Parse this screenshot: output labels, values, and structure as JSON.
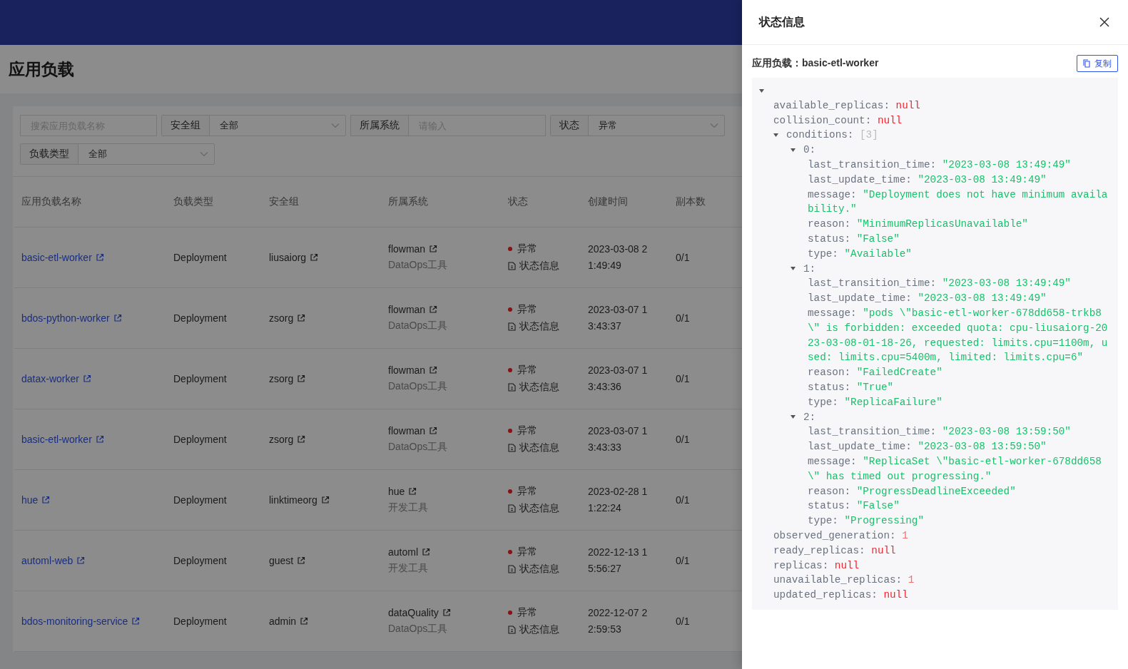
{
  "page": {
    "title": "应用负载"
  },
  "filters": [
    {
      "kind": "input",
      "placeholder": "搜索应用负载名称"
    },
    {
      "kind": "select",
      "label": "安全组",
      "value": "全部"
    },
    {
      "kind": "labeled_input",
      "label": "所属系统",
      "placeholder": "请输入"
    },
    {
      "kind": "select",
      "label": "状态",
      "value": "异常"
    },
    {
      "kind": "select",
      "label": "负载类型",
      "value": "全部"
    }
  ],
  "table": {
    "columns": [
      "应用负载名称",
      "负载类型",
      "安全组",
      "所属系统",
      "状态",
      "创建时间",
      "副本数"
    ],
    "rows": [
      {
        "name": "basic-etl-worker",
        "type": "Deployment",
        "security_group": "liusaiorg",
        "system": "flowman",
        "system_category": "DataOps工具",
        "status": "异常",
        "status_link": "状态信息",
        "created": "2023-03-08 21:49:49",
        "replicas": "0/1"
      },
      {
        "name": "bdos-python-worker",
        "type": "Deployment",
        "security_group": "zsorg",
        "system": "flowman",
        "system_category": "DataOps工具",
        "status": "异常",
        "status_link": "状态信息",
        "created": "2023-03-07 13:43:37",
        "replicas": "0/1"
      },
      {
        "name": "datax-worker",
        "type": "Deployment",
        "security_group": "zsorg",
        "system": "flowman",
        "system_category": "DataOps工具",
        "status": "异常",
        "status_link": "状态信息",
        "created": "2023-03-07 13:43:36",
        "replicas": "0/1"
      },
      {
        "name": "basic-etl-worker",
        "type": "Deployment",
        "security_group": "zsorg",
        "system": "flowman",
        "system_category": "DataOps工具",
        "status": "异常",
        "status_link": "状态信息",
        "created": "2023-03-07 13:43:33",
        "replicas": "0/1"
      },
      {
        "name": "hue",
        "type": "Deployment",
        "security_group": "linktimeorg",
        "system": "hue",
        "system_category": "开发工具",
        "status": "异常",
        "status_link": "状态信息",
        "created": "2023-02-28 11:22:24",
        "replicas": "0/1"
      },
      {
        "name": "automl-web",
        "type": "Deployment",
        "security_group": "guest",
        "system": "automl",
        "system_category": "开发工具",
        "status": "异常",
        "status_link": "状态信息",
        "created": "2022-12-13 15:56:27",
        "replicas": "0/1"
      },
      {
        "name": "bdos-monitoring-service",
        "type": "Deployment",
        "security_group": "admin",
        "system": "dataQuality",
        "system_category": "DataOps工具",
        "status": "异常",
        "status_link": "状态信息",
        "created": "2022-12-07 22:59:53",
        "replicas": "0/1"
      }
    ]
  },
  "drawer": {
    "title": "状态信息",
    "subtitle": "应用负载：basic-etl-worker",
    "copy_button": "复制",
    "tree": {
      "expanded": true,
      "children": [
        {
          "key": "available_replicas:",
          "value": "null",
          "kind": "null"
        },
        {
          "key": "collision_count:",
          "value": "null",
          "kind": "null"
        },
        {
          "key": "conditions:",
          "count": "[3]",
          "expanded": true,
          "children": [
            {
              "key": "0:",
              "expanded": true,
              "children": [
                {
                  "key": "last_transition_time:",
                  "value": "\"2023-03-08 13:49:49\"",
                  "kind": "string"
                },
                {
                  "key": "last_update_time:",
                  "value": "\"2023-03-08 13:49:49\"",
                  "kind": "string"
                },
                {
                  "key": "message:",
                  "value": "\"Deployment does not have minimum availability.\"",
                  "kind": "string"
                },
                {
                  "key": "reason:",
                  "value": "\"MinimumReplicasUnavailable\"",
                  "kind": "string"
                },
                {
                  "key": "status:",
                  "value": "\"False\"",
                  "kind": "string"
                },
                {
                  "key": "type:",
                  "value": "\"Available\"",
                  "kind": "string"
                }
              ]
            },
            {
              "key": "1:",
              "expanded": true,
              "children": [
                {
                  "key": "last_transition_time:",
                  "value": "\"2023-03-08 13:49:49\"",
                  "kind": "string"
                },
                {
                  "key": "last_update_time:",
                  "value": "\"2023-03-08 13:49:49\"",
                  "kind": "string"
                },
                {
                  "key": "message:",
                  "value": "\"pods \\\"basic-etl-worker-678dd658-trkb8\\\" is forbidden: exceeded quota: cpu-liusaiorg-2023-03-08-01-18-26, requested: limits.cpu=1100m, used: limits.cpu=5400m, limited: limits.cpu=6\"",
                  "kind": "string"
                },
                {
                  "key": "reason:",
                  "value": "\"FailedCreate\"",
                  "kind": "string"
                },
                {
                  "key": "status:",
                  "value": "\"True\"",
                  "kind": "string"
                },
                {
                  "key": "type:",
                  "value": "\"ReplicaFailure\"",
                  "kind": "string"
                }
              ]
            },
            {
              "key": "2:",
              "expanded": true,
              "children": [
                {
                  "key": "last_transition_time:",
                  "value": "\"2023-03-08 13:59:50\"",
                  "kind": "string"
                },
                {
                  "key": "last_update_time:",
                  "value": "\"2023-03-08 13:59:50\"",
                  "kind": "string"
                },
                {
                  "key": "message:",
                  "value": "\"ReplicaSet \\\"basic-etl-worker-678dd658\\\" has timed out progressing.\"",
                  "kind": "string"
                },
                {
                  "key": "reason:",
                  "value": "\"ProgressDeadlineExceeded\"",
                  "kind": "string"
                },
                {
                  "key": "status:",
                  "value": "\"False\"",
                  "kind": "string"
                },
                {
                  "key": "type:",
                  "value": "\"Progressing\"",
                  "kind": "string"
                }
              ]
            }
          ]
        },
        {
          "key": "observed_generation:",
          "value": "1",
          "kind": "number"
        },
        {
          "key": "ready_replicas:",
          "value": "null",
          "kind": "null"
        },
        {
          "key": "replicas:",
          "value": "null",
          "kind": "null"
        },
        {
          "key": "unavailable_replicas:",
          "value": "1",
          "kind": "number"
        },
        {
          "key": "updated_replicas:",
          "value": "null",
          "kind": "null"
        }
      ]
    }
  }
}
